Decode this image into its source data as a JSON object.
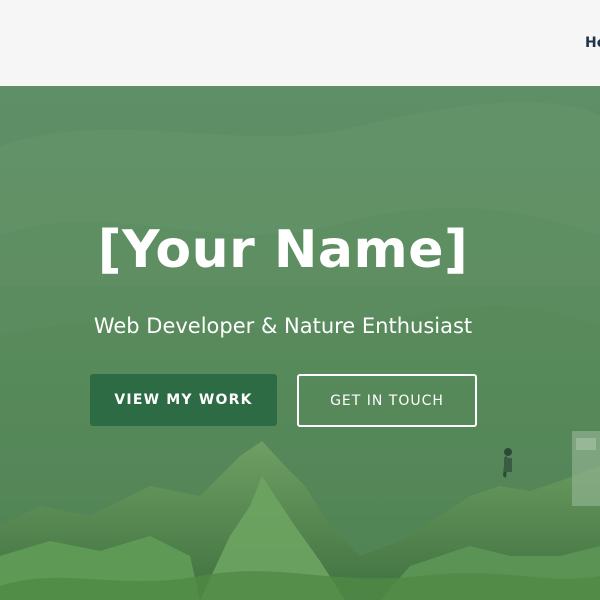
{
  "nav": {
    "links": [
      {
        "label": "Ho"
      }
    ]
  },
  "hero": {
    "title": "[Your Name]",
    "subtitle": "Web Developer & Nature Enthusiast",
    "primary_button": "VIEW MY WORK",
    "secondary_button": "GET IN TOUCH"
  },
  "colors": {
    "nav_background": "#f5f6f5",
    "nav_text": "#1f3448",
    "hero_overlay": "#5c8c63",
    "primary_button": "#2d6b44",
    "text_on_hero": "#ffffff"
  }
}
